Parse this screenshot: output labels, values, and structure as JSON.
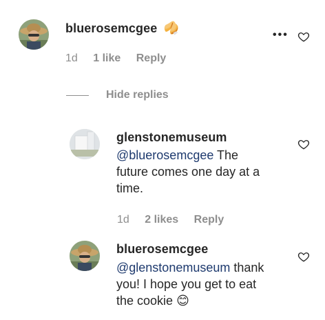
{
  "comments": [
    {
      "username": "bluerosemcgee",
      "emoji": "🥠",
      "time": "1d",
      "likes": "1 like",
      "reply": "Reply"
    }
  ],
  "hide_replies": "Hide replies",
  "replies": [
    {
      "username": "glenstonemuseum",
      "mention": "@bluerosemcgee",
      "text_line1": " The",
      "text_line2": "future comes one day at a",
      "text_line3": "time.",
      "time": "1d",
      "likes": "2 likes",
      "reply": "Reply"
    },
    {
      "username": "bluerosemcgee",
      "mention": "@glenstonemuseum",
      "text_line1": " thank",
      "text_line2": "you! I hope you get to eat",
      "text_line3": "the cookie",
      "emoji": "😊"
    }
  ],
  "icons": {
    "more": "more-options-icon",
    "heart": "heart-outline-icon"
  }
}
